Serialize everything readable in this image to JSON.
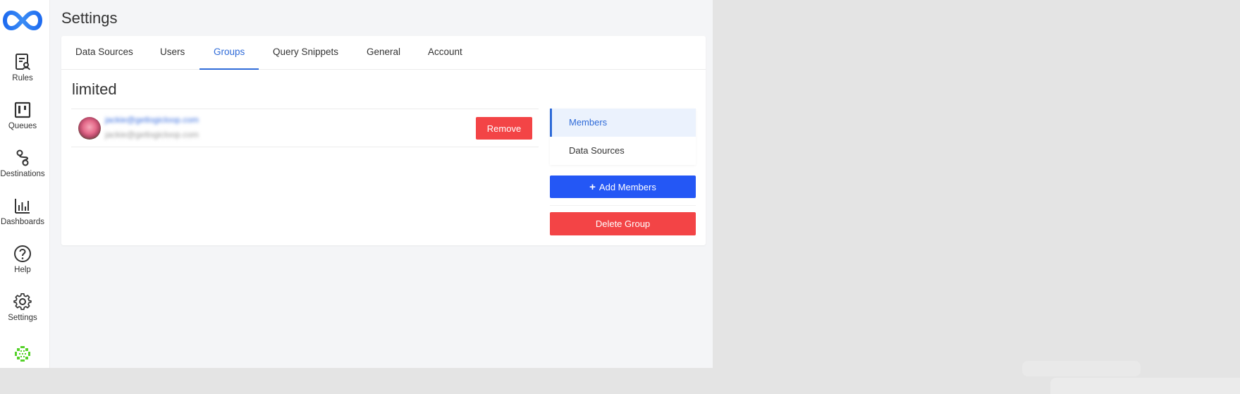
{
  "sidebar": {
    "logo_icon": "infinity-logo-icon",
    "items": [
      {
        "label": "Rules",
        "icon": "rules-icon"
      },
      {
        "label": "Queues",
        "icon": "queues-icon"
      },
      {
        "label": "Destinations",
        "icon": "destinations-icon"
      },
      {
        "label": "Dashboards",
        "icon": "dashboards-icon"
      },
      {
        "label": "Help",
        "icon": "help-icon"
      },
      {
        "label": "Settings",
        "icon": "gear-icon"
      }
    ],
    "bottom_icon": "app-status-icon"
  },
  "page": {
    "title": "Settings"
  },
  "tabs": [
    {
      "label": "Data Sources"
    },
    {
      "label": "Users"
    },
    {
      "label": "Groups"
    },
    {
      "label": "Query Snippets"
    },
    {
      "label": "General"
    },
    {
      "label": "Account"
    }
  ],
  "active_tab": "Groups",
  "group": {
    "name": "limited",
    "members": [
      {
        "name": "jackie@getlogicloop.com",
        "email": "jackie@getlogicloop.com",
        "remove_label": "Remove"
      }
    ]
  },
  "side_menu": {
    "items": [
      {
        "label": "Members"
      },
      {
        "label": "Data Sources"
      }
    ],
    "active": "Members"
  },
  "actions": {
    "add_members_label": "Add Members",
    "delete_group_label": "Delete Group"
  },
  "colors": {
    "accent": "#2f6bd8",
    "primary_button": "#2457f5",
    "danger": "#f34446",
    "logo_blue": "#2a6ee8",
    "status_green": "#55d12a"
  }
}
